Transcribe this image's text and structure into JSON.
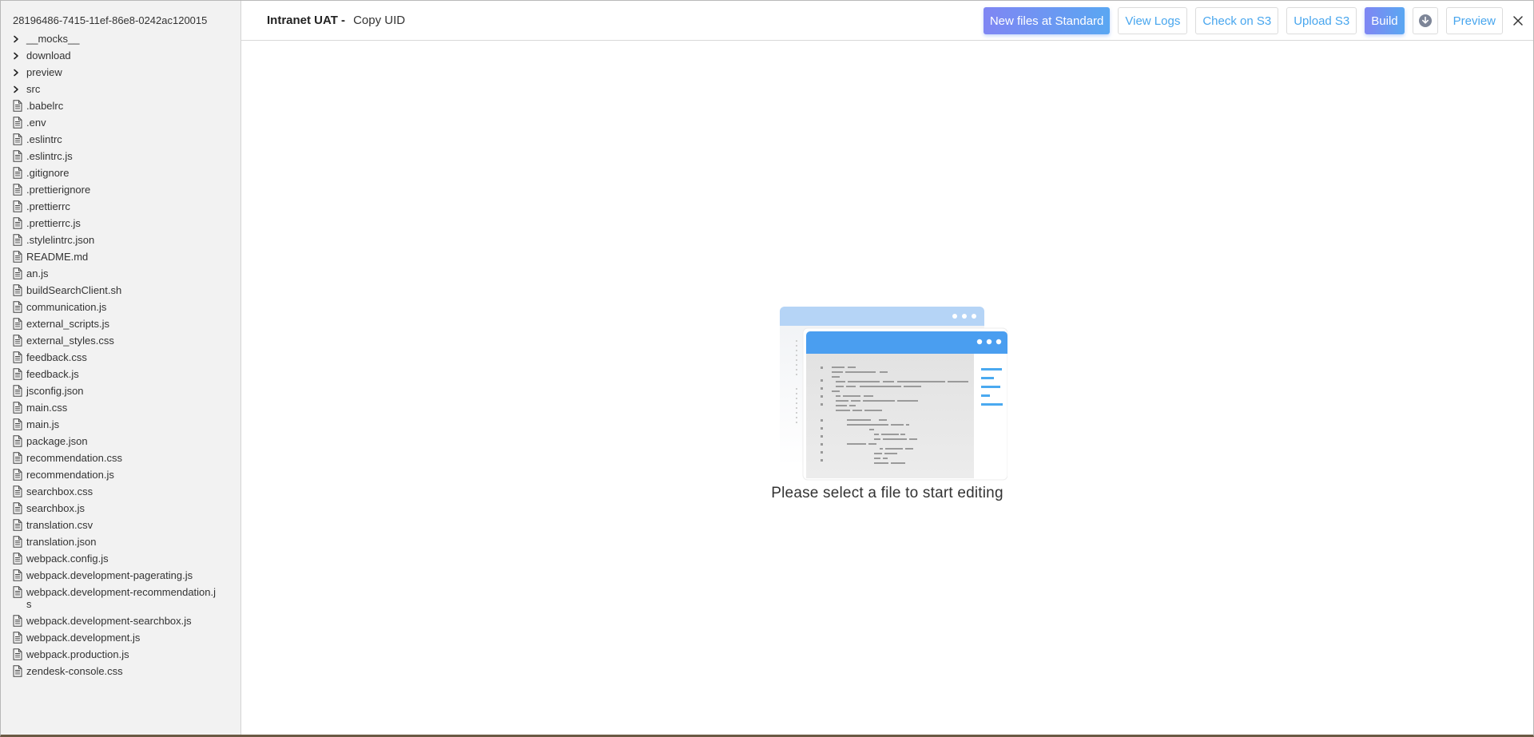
{
  "sidebar": {
    "repo_id": "28196486-7415-11ef-86e8-0242ac120015",
    "items": [
      {
        "type": "folder",
        "name": "__mocks__"
      },
      {
        "type": "folder",
        "name": "download"
      },
      {
        "type": "folder",
        "name": "preview"
      },
      {
        "type": "folder",
        "name": "src"
      },
      {
        "type": "file",
        "name": ".babelrc"
      },
      {
        "type": "file",
        "name": ".env"
      },
      {
        "type": "file",
        "name": ".eslintrc"
      },
      {
        "type": "file",
        "name": ".eslintrc.js"
      },
      {
        "type": "file",
        "name": ".gitignore"
      },
      {
        "type": "file",
        "name": ".prettierignore"
      },
      {
        "type": "file",
        "name": ".prettierrc"
      },
      {
        "type": "file",
        "name": ".prettierrc.js"
      },
      {
        "type": "file",
        "name": ".stylelintrc.json"
      },
      {
        "type": "file",
        "name": "README.md"
      },
      {
        "type": "file",
        "name": "an.js"
      },
      {
        "type": "file",
        "name": "buildSearchClient.sh"
      },
      {
        "type": "file",
        "name": "communication.js"
      },
      {
        "type": "file",
        "name": "external_scripts.js"
      },
      {
        "type": "file",
        "name": "external_styles.css"
      },
      {
        "type": "file",
        "name": "feedback.css"
      },
      {
        "type": "file",
        "name": "feedback.js"
      },
      {
        "type": "file",
        "name": "jsconfig.json"
      },
      {
        "type": "file",
        "name": "main.css"
      },
      {
        "type": "file",
        "name": "main.js"
      },
      {
        "type": "file",
        "name": "package.json"
      },
      {
        "type": "file",
        "name": "recommendation.css"
      },
      {
        "type": "file",
        "name": "recommendation.js"
      },
      {
        "type": "file",
        "name": "searchbox.css"
      },
      {
        "type": "file",
        "name": "searchbox.js"
      },
      {
        "type": "file",
        "name": "translation.csv"
      },
      {
        "type": "file",
        "name": "translation.json"
      },
      {
        "type": "file",
        "name": "webpack.config.js"
      },
      {
        "type": "file",
        "name": "webpack.development-pagerating.js"
      },
      {
        "type": "file",
        "name": "webpack.development-recommendation.js"
      },
      {
        "type": "file",
        "name": "webpack.development-searchbox.js"
      },
      {
        "type": "file",
        "name": "webpack.development.js"
      },
      {
        "type": "file",
        "name": "webpack.production.js"
      },
      {
        "type": "file",
        "name": "zendesk-console.css"
      }
    ]
  },
  "header": {
    "project": "Intranet UAT -",
    "copy_uid": "Copy UID"
  },
  "toolbar": {
    "new_files_label": "New files at Standard",
    "view_logs_label": "View Logs",
    "check_s3_label": "Check on S3",
    "upload_s3_label": "Upload S3",
    "build_label": "Build",
    "download_icon": "download-icon",
    "preview_label": "Preview",
    "close_icon": "close-icon"
  },
  "empty_state": {
    "message": "Please select a file to start editing",
    "illustration_icon": "code-editor-illustration"
  },
  "colors": {
    "accent": "#48a6ee",
    "gradient_start": "#7f86f3",
    "gradient_end": "#5aa7f2",
    "sidebar_bg": "#f2f2f2"
  }
}
